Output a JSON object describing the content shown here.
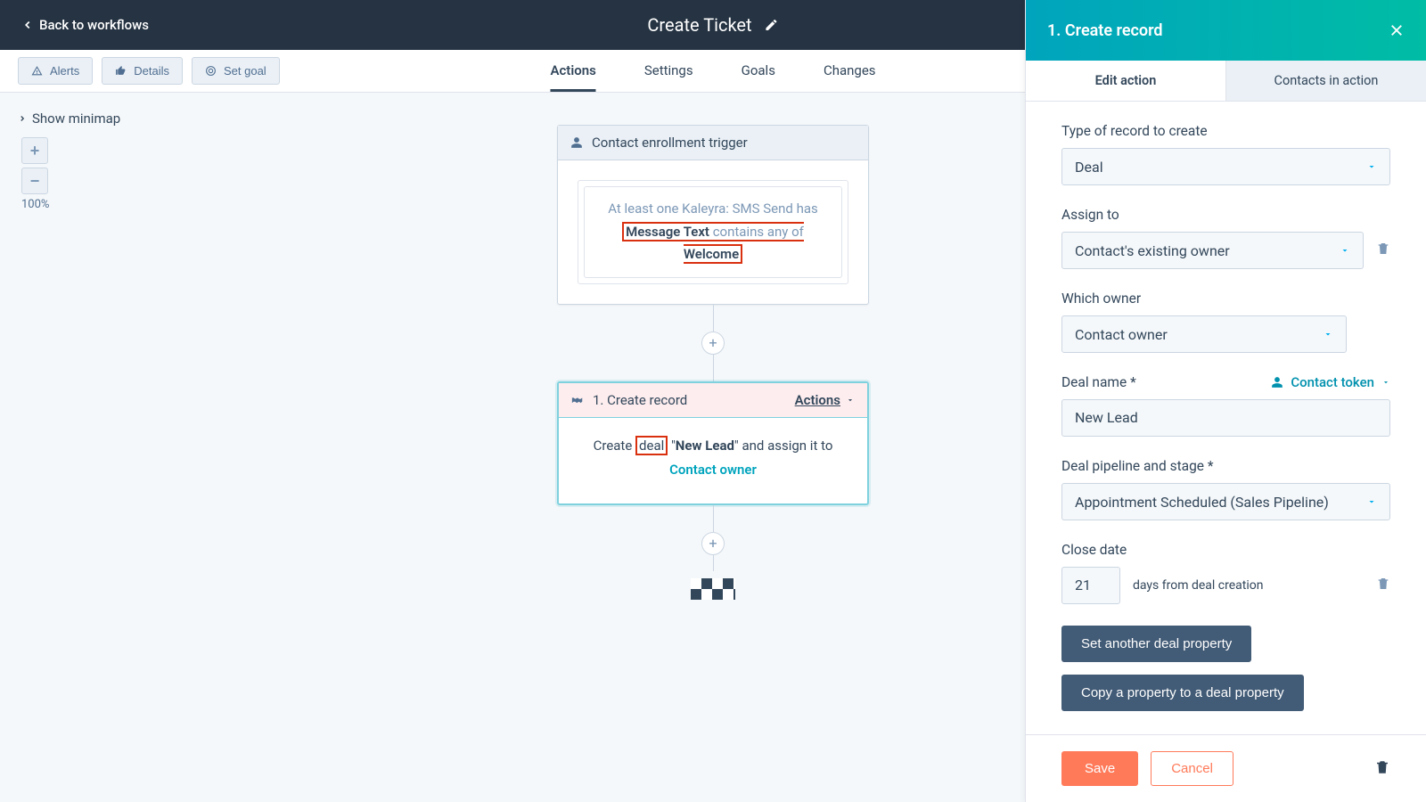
{
  "topbar": {
    "back_label": "Back to workflows",
    "title": "Create Ticket"
  },
  "toolbar": {
    "alerts": "Alerts",
    "details": "Details",
    "set_goal": "Set goal"
  },
  "tabs": {
    "actions": "Actions",
    "settings": "Settings",
    "goals": "Goals",
    "changes": "Changes"
  },
  "canvas": {
    "show_minimap": "Show minimap",
    "zoom_level": "100%"
  },
  "trigger": {
    "header": "Contact enrollment trigger",
    "line_prefix": "At least one Kaleyra: SMS Send has",
    "prop": "Message Text",
    "mid": "contains any of",
    "value": "Welcome"
  },
  "step": {
    "header": "1. Create record",
    "actions_label": "Actions",
    "desc_prefix": "Create",
    "desc_deal": "deal",
    "desc_name_quote_open": " \"",
    "desc_name": "New Lead",
    "desc_name_quote_close": "\" ",
    "desc_assign": "and assign it to",
    "desc_owner": "Contact owner"
  },
  "panel": {
    "title": "1. Create record",
    "tab_edit": "Edit action",
    "tab_contacts": "Contacts in action",
    "record_type_label": "Type of record to create",
    "record_type_value": "Deal",
    "assign_to_label": "Assign to",
    "assign_to_value": "Contact's existing owner",
    "which_owner_label": "Which owner",
    "which_owner_value": "Contact owner",
    "deal_name_label": "Deal name *",
    "contact_token": "Contact token",
    "deal_name_value": "New Lead",
    "pipeline_label": "Deal pipeline and stage *",
    "pipeline_value": "Appointment Scheduled (Sales Pipeline)",
    "close_date_label": "Close date",
    "close_days_value": "21",
    "close_days_suffix": "days from deal creation",
    "set_another": "Set another deal property",
    "copy_prop": "Copy a property to a deal property",
    "save": "Save",
    "cancel": "Cancel"
  }
}
